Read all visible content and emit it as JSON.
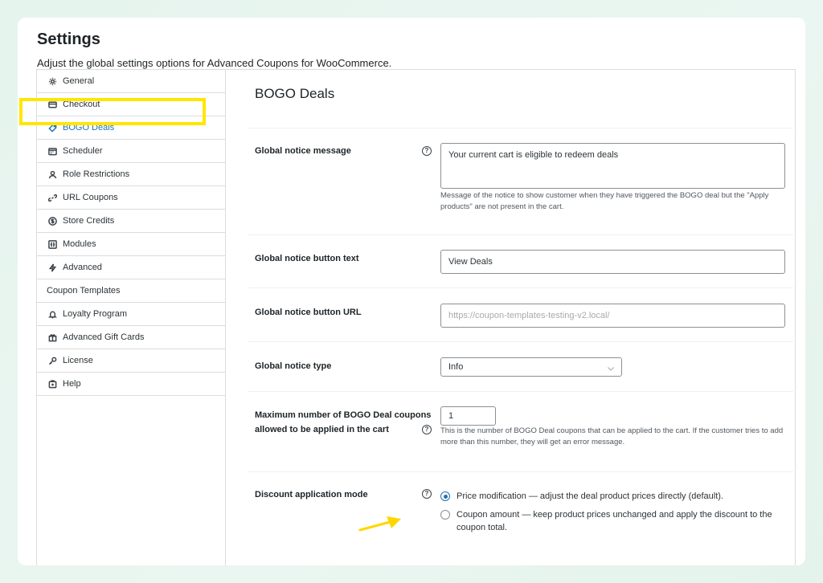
{
  "header": {
    "title": "Settings",
    "description": "Adjust the global settings options for Advanced Coupons for WooCommerce."
  },
  "sidebar": {
    "items": [
      {
        "label": "General",
        "icon": "gear-icon"
      },
      {
        "label": "Checkout",
        "icon": "card-icon"
      },
      {
        "label": "BOGO Deals",
        "icon": "tag-icon",
        "active": true
      },
      {
        "label": "Scheduler",
        "icon": "calendar-icon"
      },
      {
        "label": "Role Restrictions",
        "icon": "user-icon"
      },
      {
        "label": "URL Coupons",
        "icon": "link-icon"
      },
      {
        "label": "Store Credits",
        "icon": "dollar-circle-icon"
      },
      {
        "label": "Modules",
        "icon": "grid-icon"
      },
      {
        "label": "Advanced",
        "icon": "bolt-icon"
      },
      {
        "label": "Coupon Templates",
        "icon": ""
      },
      {
        "label": "Loyalty Program",
        "icon": "bell-icon"
      },
      {
        "label": "Advanced Gift Cards",
        "icon": "gift-icon"
      },
      {
        "label": "License",
        "icon": "key-icon"
      },
      {
        "label": "Help",
        "icon": "help-box-icon"
      }
    ]
  },
  "main": {
    "section_title": "BOGO Deals",
    "fields": {
      "notice_message": {
        "label": "Global notice message",
        "value": "Your current cart is eligible to redeem deals",
        "description": "Message of the notice to show customer when they have triggered the BOGO deal but the \"Apply products\" are not present in the cart."
      },
      "button_text": {
        "label": "Global notice button text",
        "value": "View Deals"
      },
      "button_url": {
        "label": "Global notice button URL",
        "placeholder": "https://coupon-templates-testing-v2.local/"
      },
      "notice_type": {
        "label": "Global notice type",
        "selected": "Info"
      },
      "max_coupons": {
        "label_line1": "Maximum number of BOGO Deal coupons",
        "label_line2": "allowed to be applied in the cart",
        "value": "1",
        "description": "This is the number of BOGO Deal coupons that can be applied to the cart. If the customer tries to add more than this number, they will get an error message."
      },
      "discount_mode": {
        "label": "Discount application mode",
        "options": [
          {
            "label": "Price modification — adjust the deal product prices directly (default).",
            "checked": true
          },
          {
            "label": "Coupon amount — keep product prices unchanged and apply the discount to the coupon total.",
            "checked": false
          }
        ]
      }
    }
  },
  "colors": {
    "accent": "#2271b1",
    "highlight": "#ffe600",
    "arrow": "#ffd600"
  }
}
